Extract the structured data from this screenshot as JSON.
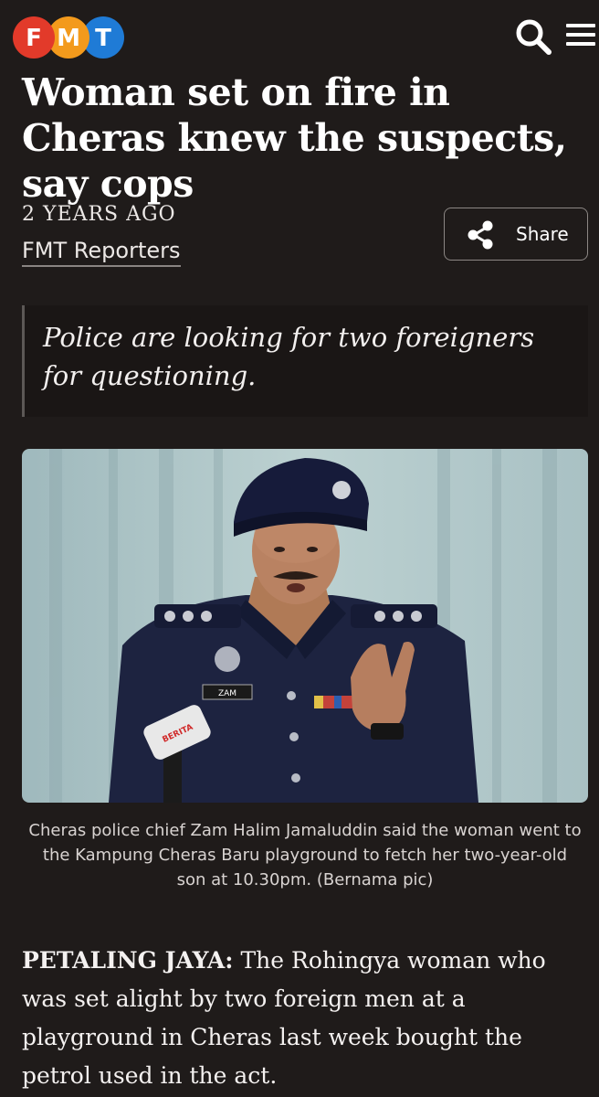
{
  "header": {
    "logo_letters": [
      "F",
      "M",
      "T"
    ],
    "logo_colors": [
      "#e23a2a",
      "#f39a1c",
      "#1f7bd6"
    ],
    "search_icon": "search-icon",
    "menu_icon": "hamburger-menu-icon"
  },
  "article": {
    "headline": "Woman set on fire in Cheras knew the suspects, say cops",
    "time_ago": "2 YEARS AGO",
    "author": "FMT Reporters",
    "share_label": "Share",
    "standfirst": "Police are looking for two foreigners for questioning.",
    "photo": {
      "name_tag": "ZAM",
      "mic_label": "BERITA"
    },
    "caption": "Cheras police chief Zam Halim Jamaluddin said the woman went to the Kampung Cheras Baru playground to fetch her two-year-old son at 10.30pm. (Bernama pic)",
    "dateline": "PETALING JAYA:",
    "lead": " The Rohingya woman who was set alight by two foreign men at a playground in Cheras last week bought the petrol used in the act."
  },
  "theme": {
    "background": "#1f1b1a",
    "text": "#ffffff"
  }
}
